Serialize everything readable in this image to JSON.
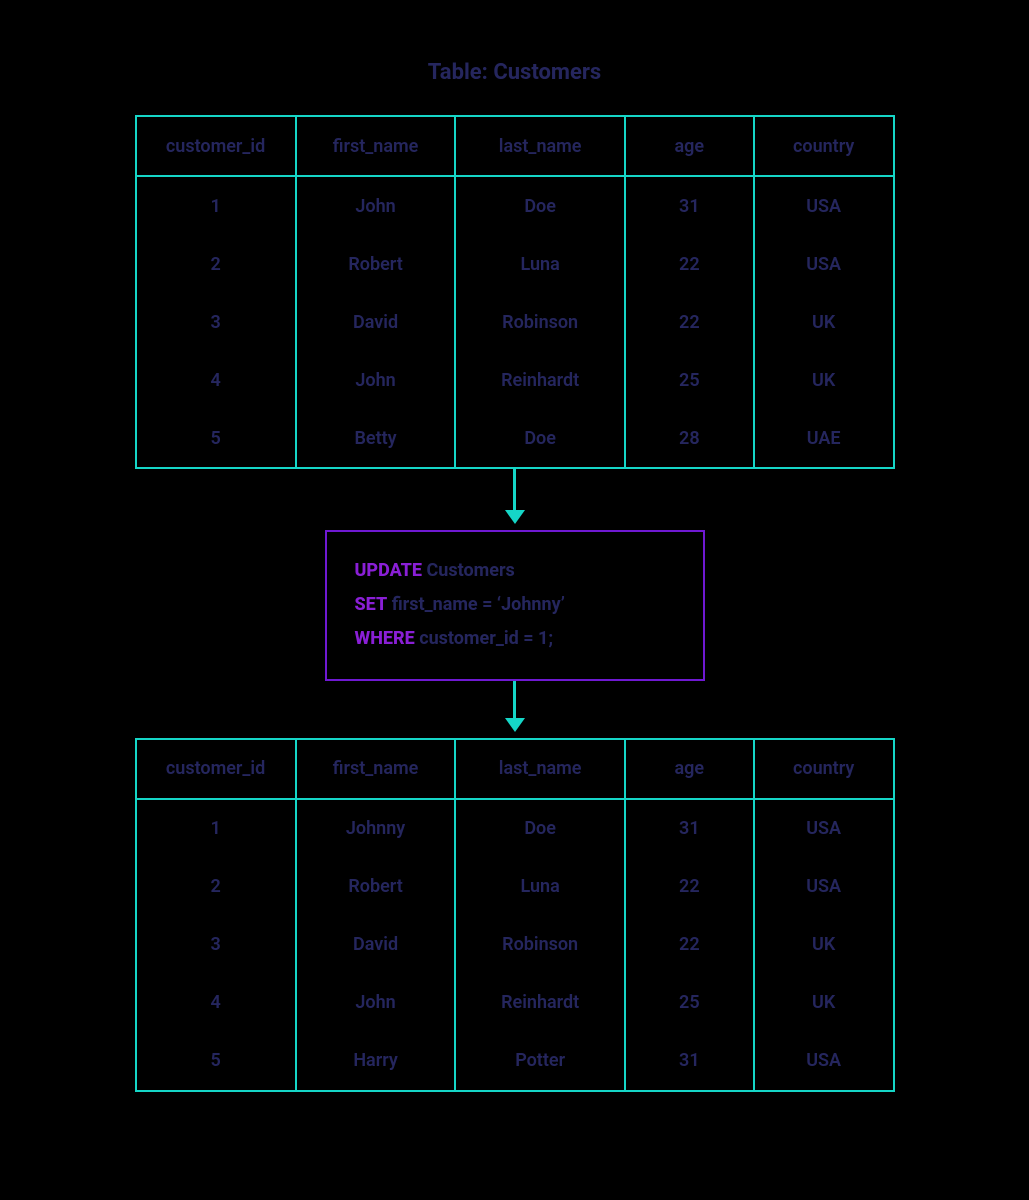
{
  "title": "Table: Customers",
  "columns": [
    "customer_id",
    "first_name",
    "last_name",
    "age",
    "country"
  ],
  "before": [
    {
      "id": "1",
      "fn": "John",
      "ln": "Doe",
      "age": "31",
      "ctry": "USA"
    },
    {
      "id": "2",
      "fn": "Robert",
      "ln": "Luna",
      "age": "22",
      "ctry": "USA"
    },
    {
      "id": "3",
      "fn": "David",
      "ln": "Robinson",
      "age": "22",
      "ctry": "UK"
    },
    {
      "id": "4",
      "fn": "John",
      "ln": "Reinhardt",
      "age": "25",
      "ctry": "UK"
    },
    {
      "id": "5",
      "fn": "Betty",
      "ln": "Doe",
      "age": "28",
      "ctry": "UAE"
    }
  ],
  "after": [
    {
      "id": "1",
      "fn": "Johnny",
      "ln": "Doe",
      "age": "31",
      "ctry": "USA"
    },
    {
      "id": "2",
      "fn": "Robert",
      "ln": "Luna",
      "age": "22",
      "ctry": "USA"
    },
    {
      "id": "3",
      "fn": "David",
      "ln": "Robinson",
      "age": "22",
      "ctry": "UK"
    },
    {
      "id": "4",
      "fn": "John",
      "ln": "Reinhardt",
      "age": "25",
      "ctry": "UK"
    },
    {
      "id": "5",
      "fn": "Harry",
      "ln": "Potter",
      "age": "31",
      "ctry": "USA"
    }
  ],
  "sql": {
    "kw_update": "UPDATE",
    "tbl": "Customers",
    "kw_set": "SET",
    "set_expr": "first_name = ‘Johnny’",
    "kw_where": "WHERE",
    "where_expr": "customer_id = 1;"
  }
}
